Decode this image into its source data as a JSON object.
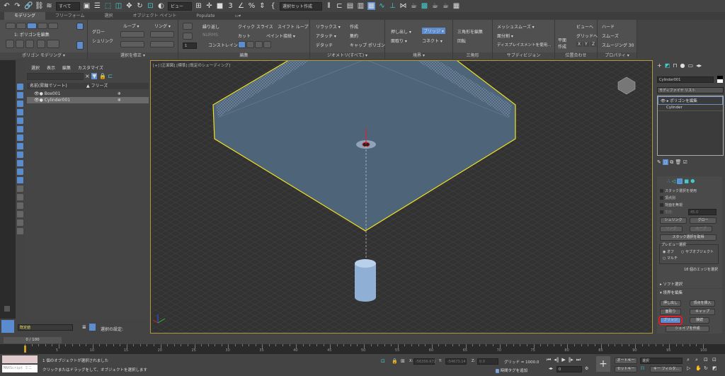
{
  "toolbar": {
    "filter": "すべて",
    "ref_coord": "ビュー",
    "selection_set": "選択セット作成"
  },
  "ribbon": {
    "tabs": [
      "モデリング",
      "フリーフォーム",
      "選択",
      "オブジェクト ペイント",
      "Populate"
    ],
    "active_tab": "モデリング",
    "groups": {
      "poly_modeling": {
        "label": "ポリゴン モデリング ▾",
        "stack_label": "1: ポリゴンを編集"
      },
      "modify_selection": {
        "label": "選択を修正 ▾",
        "grow": "グロー",
        "shrink": "シュリンク",
        "loop": "ループ ▾",
        "ring": "リング ▾",
        "spinner": "1"
      },
      "edit": {
        "label": "編集",
        "repeat": "繰り返し",
        "quickslice": "クイック スライス",
        "swiftloop": "スイフト ループ",
        "nurms": "NURMS",
        "cut": "カット",
        "paint_connect": "ペイント接続 ▾",
        "constraints": "コンストレイント:"
      },
      "geometry": {
        "label": "ジオメトリ(すべて) ▾",
        "relax": "リラックス ▾",
        "create": "作成",
        "attach": "アタッチ ▾",
        "collapse": "集約",
        "detach": "デタッチ",
        "cap": "キャップ ポリゴン"
      },
      "border": {
        "label": "境界 ▾",
        "extrude": "押し出し ▾",
        "bridge": "ブリッジ ▾",
        "chamfer": "面取り ▾",
        "connect": "コネクト ▾"
      },
      "triangles": {
        "label": "三角形",
        "edit_tri": "三角形を編集",
        "turn": "回転"
      },
      "subdivision": {
        "label": "サブディビジョン",
        "meshsmooth": "メッシュスムーズ ▾",
        "tessellate": "面分割 ▾",
        "displacement": "ディスプレイスメントを使用..."
      },
      "align": {
        "label": "位置合わせ",
        "make_planar": "平面\n作成",
        "to_view": "ビューへ",
        "to_grid": "グリッドへ",
        "x": "X",
        "y": "Y",
        "z": "Z"
      },
      "properties": {
        "label": "プロパティ ▾",
        "hard": "ハード",
        "smooth": "スムーズ",
        "smooth30": "スムージング 30"
      }
    }
  },
  "explorer": {
    "menu": [
      "選択",
      "表示",
      "編集",
      "カスタマイズ"
    ],
    "col_name": "名前(昇順でソート)",
    "col_freeze": "▲ フリーズ",
    "rows": [
      {
        "name": "Box001",
        "selected": false
      },
      {
        "name": "Cylinder001",
        "selected": true
      }
    ]
  },
  "viewport": {
    "label": "[+] [正面図] [標準] [既定のシェーディング]"
  },
  "command_panel": {
    "object_name": "Cylinder001",
    "modifier_list": "モディファイヤ リスト",
    "stack": [
      "ポリゴンを編集",
      "Cylinder"
    ],
    "selection": {
      "use_stack": "スタック選択を使用",
      "by_vertex": "頂点別",
      "ignore_backfacing": "背面を無視",
      "angle_label": "角度:",
      "angle": "45.0",
      "shrink": "シュリンク",
      "grow": "グロー",
      "ring": "リング",
      "loop": "ループ",
      "get_stack": "スタック選択を取得",
      "preview": "プレビュー選択",
      "off": "オフ",
      "subobject": "サブオブジェクト",
      "multi": "マルチ",
      "status": "18 個のエッジを選択"
    },
    "soft_selection": "ソフト選択",
    "edit_borders": {
      "title": "境界を編集",
      "extrude": "押し出し",
      "insert_vertex": "頂点を挿入",
      "chamfer": "面取り",
      "cap": "キャップ",
      "bridge": "ブリッジ",
      "connect": "接続",
      "create_shape": "シェイプを作成"
    },
    "highlight_color": "#e0202a"
  },
  "bottom": {
    "layer": "既定値",
    "selection_set_label": "選択の設定:",
    "frame": "0 / 100",
    "ticks": [
      "5",
      "10",
      "15",
      "20",
      "25",
      "30",
      "35",
      "40",
      "45",
      "50",
      "55",
      "60",
      "65",
      "70",
      "75",
      "80",
      "85",
      "90",
      "95",
      "100"
    ],
    "maxscript": "MAXScript ミニ",
    "status1": "1 個のオブジェクトが選択されました",
    "status2": "クリックまたはドラッグをして、オブジェクトを選択します",
    "x_label": "X:",
    "x": "-56356.672",
    "y_label": "Y:",
    "y": "-54673.14",
    "z_label": "Z:",
    "z": "0.0",
    "grid": "グリッド = 1000.0",
    "add_time_tag": "時間タグを追加",
    "auto_key": "オートキー",
    "set_key": "セットキー",
    "key_filter_sel": "選択",
    "key_filters": "キー フィルタ...",
    "frame_field": "0"
  }
}
